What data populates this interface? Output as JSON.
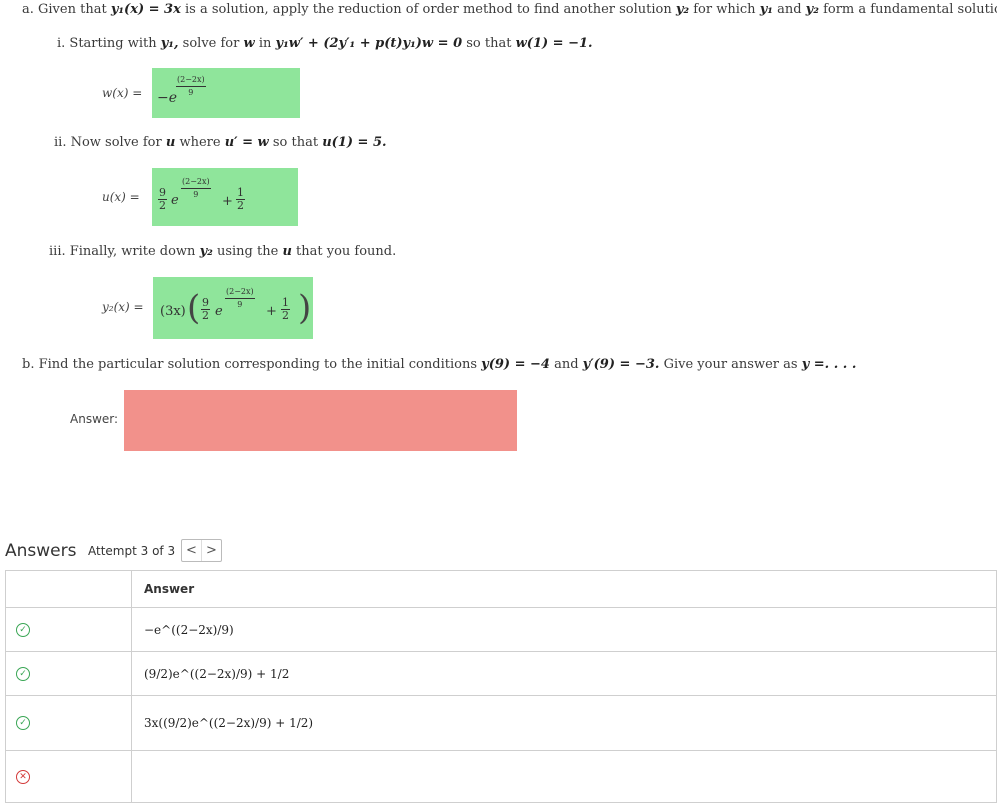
{
  "part_a": {
    "lead": "a. Given that",
    "y1_def": "y₁(x) = 3x",
    "rest": "is a solution, apply the reduction of order method to find another solution",
    "y2": "y₂",
    "for_which": "for which",
    "y1": "y₁",
    "and": "and",
    "tail": "form a fundamental solution set."
  },
  "step_i": {
    "lead": "i. Starting with",
    "y1": "y₁,",
    "mid": "solve for",
    "w": "w",
    "in": "in",
    "equation": "y₁w′ + (2y′₁ + p(t)y₁)w = 0",
    "so_that": "so that",
    "condition": "w(1) = −1.",
    "field_label": "w(x) =",
    "answer": {
      "sign": "−e",
      "exp": "(2−2x)",
      "exp_den": "9"
    }
  },
  "step_ii": {
    "lead": "ii. Now solve for",
    "u": "u",
    "where": "where",
    "equation": "u′ = w",
    "so_that": "so that",
    "condition": "u(1) = 5.",
    "field_label": "u(x) =",
    "answer": {
      "coef_num": "9",
      "coef_den": "2",
      "e": "e",
      "exp": "(2−2x)",
      "exp_den": "9",
      "plus": "+",
      "c_num": "1",
      "c_den": "2"
    }
  },
  "step_iii": {
    "lead": "iii. Finally, write down",
    "y2": "y₂",
    "using": "using the",
    "u": "u",
    "tail": "that you found.",
    "field_label": "y₂(x) =",
    "answer": {
      "factor": "(3x)",
      "coef_num": "9",
      "coef_den": "2",
      "e": "e",
      "exp": "(2−2x)",
      "exp_den": "9",
      "plus": "+",
      "c_num": "1",
      "c_den": "2"
    }
  },
  "part_b": {
    "lead": "b. Find the particular solution corresponding to the initial conditions",
    "ic1": "y(9) = −4",
    "and": "and",
    "ic2": "y′(9) = −3.",
    "tail": "Give your answer as",
    "form": "y =. . . .",
    "field_label": "Answer:",
    "answer": ""
  },
  "answers_panel": {
    "title": "Answers",
    "attempt": "Attempt 3 of 3",
    "prev": "<",
    "next": ">",
    "column_header": "Answer",
    "rows": [
      {
        "status": "correct",
        "value": "−e^((2−2x)/9)"
      },
      {
        "status": "correct",
        "value": "(9/2)e^((2−2x)/9) + 1/2"
      },
      {
        "status": "correct",
        "value": "3x((9/2)e^((2−2x)/9) + 1/2)"
      },
      {
        "status": "incorrect",
        "value": ""
      }
    ]
  },
  "colors": {
    "correct_fill": "#8fe59b",
    "incorrect_fill": "#f2918b",
    "correct_icon": "#3aa655",
    "incorrect_icon": "#d33a3a"
  }
}
